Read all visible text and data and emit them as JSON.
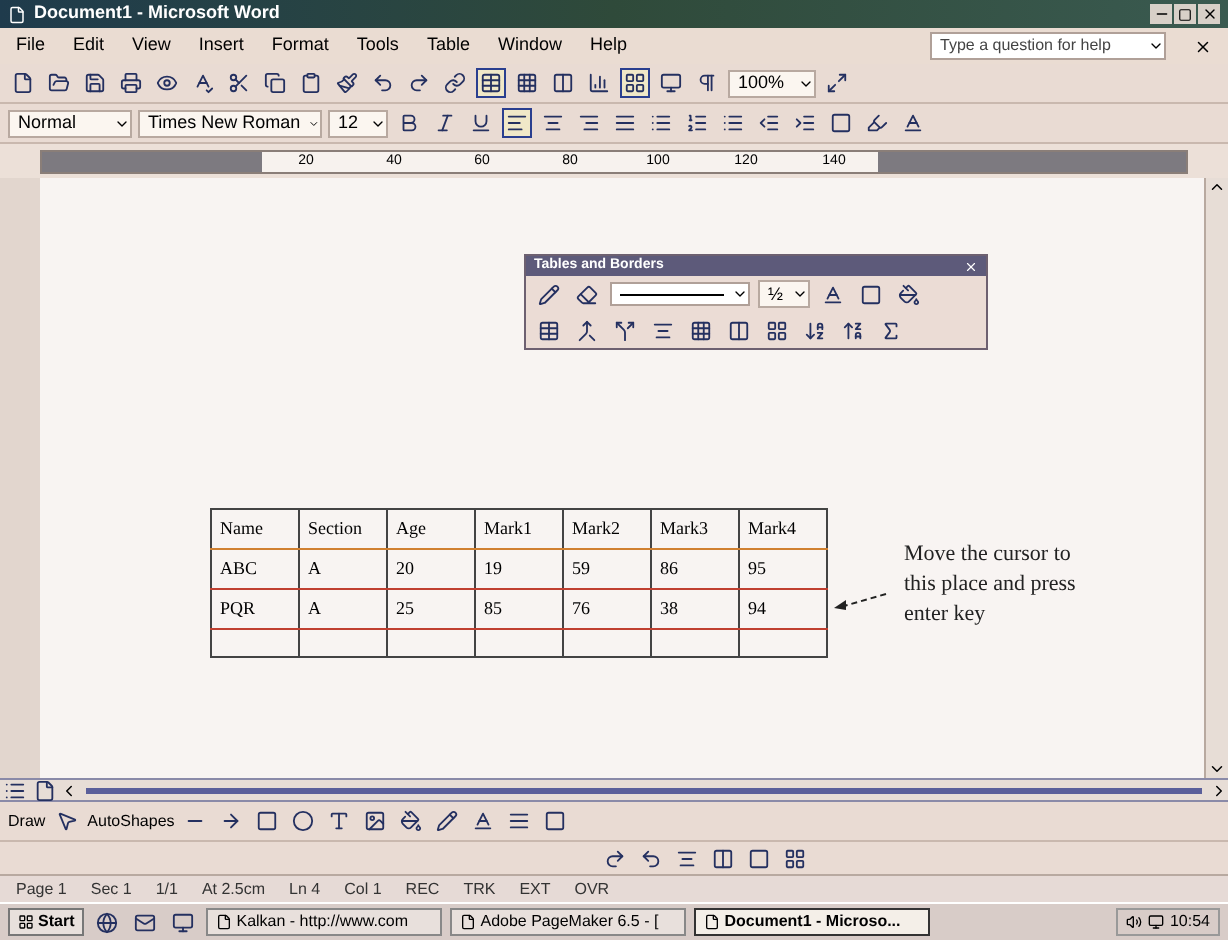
{
  "window": {
    "title": "Document1 - Microsoft Word"
  },
  "menu": [
    "File",
    "Edit",
    "View",
    "Insert",
    "Format",
    "Tools",
    "Table",
    "Window",
    "Help"
  ],
  "help_box": {
    "placeholder": "Type a question for help"
  },
  "standard_toolbar": {
    "zoom": "100%"
  },
  "formatting_toolbar": {
    "style": "Normal",
    "font": "Times New Roman",
    "size": "12"
  },
  "ruler": [
    "20",
    "40",
    "60",
    "80",
    "100",
    "120",
    "140"
  ],
  "tables_and_borders": {
    "title": "Tables and Borders",
    "line_weight": "½"
  },
  "table": {
    "columns": [
      "Name",
      "Section",
      "Age",
      "Mark1",
      "Mark2",
      "Mark3",
      "Mark4"
    ],
    "rows": [
      [
        "ABC",
        "A",
        "20",
        "19",
        "59",
        "86",
        "95"
      ],
      [
        "PQR",
        "A",
        "25",
        "85",
        "76",
        "38",
        "94"
      ]
    ]
  },
  "annotation": "Move the cursor to this place and press enter key",
  "drawing_toolbar": {
    "draw": "Draw",
    "autoshapes": "AutoShapes"
  },
  "status_bar": [
    "Page 1",
    "Sec 1",
    "1/1",
    "At 2.5cm",
    "Ln 4",
    "Col 1",
    "REC",
    "TRK",
    "EXT",
    "OVR"
  ],
  "taskbar": {
    "start": "Start",
    "items": [
      {
        "label": "Kalkan - http://www.com",
        "selected": false
      },
      {
        "label": "Adobe PageMaker 6.5 - [",
        "selected": false
      },
      {
        "label": "Document1 - Microso...",
        "selected": true
      }
    ],
    "clock": "10:54"
  }
}
